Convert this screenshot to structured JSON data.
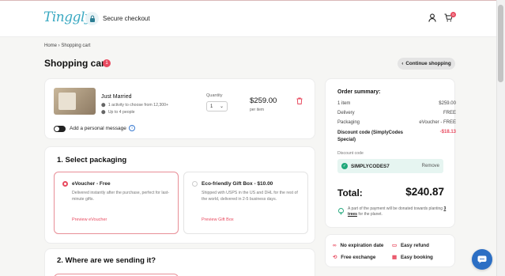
{
  "header": {
    "logo": "Tinggly",
    "secure": "Secure checkout",
    "cart_count": "0"
  },
  "breadcrumb": "Home › Shopping cart",
  "page": {
    "title": "Shopping cart",
    "count": "1",
    "continue": "Continue shopping"
  },
  "item": {
    "name": "Just Married",
    "detail1": "1 activity to choose from 12,300+",
    "detail2": "Up to 4 people",
    "qty_label": "Quantity",
    "qty": "1",
    "price": "$259.00",
    "per": "per item",
    "message": "Add a personal message"
  },
  "packaging": {
    "title": "1. Select packaging",
    "opt1": {
      "title": "eVoucher - Free",
      "desc": "Delivered instantly after the purchase, perfect for last-minute gifts.",
      "link": "Preview eVoucher"
    },
    "opt2": {
      "title": "Eco-friendly Gift Box - $10.00",
      "desc": "Shipped with USPS in the US and DHL for the rest of the world, delivered in 2-5 business days.",
      "link": "Preview Gift Box"
    }
  },
  "shipping": {
    "title": "2. Where are we sending it?"
  },
  "summary": {
    "title": "Order summary:",
    "rows": [
      {
        "label": "1 item",
        "value": "$259.00"
      },
      {
        "label": "Delivery",
        "value": "FREE"
      },
      {
        "label": "Packaging",
        "value": "eVoucher - FREE"
      },
      {
        "label": "Discount code (SimplyCodes Special)",
        "value": "-$18.13"
      }
    ],
    "code_label": "Discount code",
    "code": "SIMPLYCODES7",
    "remove": "Remove",
    "total_label": "Total:",
    "total": "$240.87",
    "donate_pre": "A part of the payment will be donated towards planting ",
    "donate_link": "3 trees",
    "donate_post": " for the planet."
  },
  "features": {
    "f1": "No expiration date",
    "f2": "Easy refund",
    "f3": "Free exchange",
    "f4": "Easy booking"
  },
  "colors": {
    "accent": "#e84a5f",
    "brand": "#3aa9c2",
    "success": "#1fa77a",
    "chat": "#2c6fc4"
  }
}
